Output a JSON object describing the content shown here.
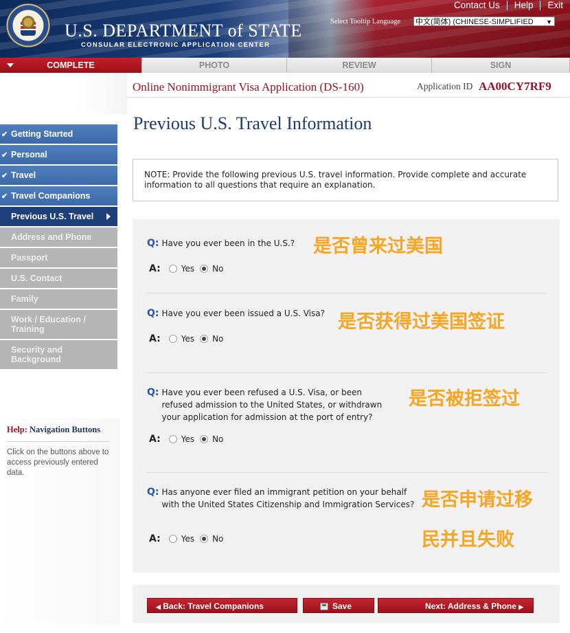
{
  "header": {
    "title": "U.S. DEPARTMENT of STATE",
    "subtitle": "CONSULAR ELECTRONIC APPLICATION CENTER",
    "links": [
      "Contact Us",
      "Help",
      "Exit"
    ],
    "tooltip_label": "Select Tooltip Language",
    "language_value": "中文(简体)  (CHINESE-SIMPLIFIED"
  },
  "tabs": [
    {
      "label": "COMPLETE",
      "active": true
    },
    {
      "label": "PHOTO"
    },
    {
      "label": "REVIEW"
    },
    {
      "label": "SIGN"
    }
  ],
  "application": {
    "title": "Online Nonimmigrant Visa Application (DS-160)",
    "id_label": "Application ID",
    "id_value": "AA00CY7RF9"
  },
  "page_title": "Previous U.S. Travel Information",
  "sidebar": {
    "items": [
      {
        "label": "Getting Started",
        "state": "done"
      },
      {
        "label": "Personal",
        "state": "done"
      },
      {
        "label": "Travel",
        "state": "done"
      },
      {
        "label": "Travel Companions",
        "state": "done"
      },
      {
        "label": "Previous U.S. Travel",
        "state": "current"
      },
      {
        "label": "Address and Phone",
        "state": "todo"
      },
      {
        "label": "Passport",
        "state": "todo"
      },
      {
        "label": "U.S. Contact",
        "state": "todo"
      },
      {
        "label": "Family",
        "state": "todo"
      },
      {
        "label": "Work / Education / Training",
        "state": "todo"
      },
      {
        "label": "Security and Background",
        "state": "todo"
      }
    ],
    "check": "✔"
  },
  "help": {
    "prefix": "Help:",
    "title": "Navigation Buttons",
    "text": "Click on the buttons above to access previously entered data."
  },
  "note": "NOTE: Provide the following previous U.S. travel information. Provide complete and accurate information to all questions that require an explanation.",
  "qa_labels": {
    "q": "Q:",
    "a": "A:",
    "yes": "Yes",
    "no": "No"
  },
  "questions": [
    {
      "text": "Have you ever been in the U.S.?",
      "answer": "No",
      "annotation": "是否曾来过美国"
    },
    {
      "text": "Have you ever been issued a U.S. Visa?",
      "answer": "No",
      "annotation": "是否获得过美国签证"
    },
    {
      "text": "Have you ever been refused a U.S. Visa, or been refused admission to the United States, or withdrawn your application for admission at the port of entry?",
      "answer": "No",
      "annotation": "是否被拒签过"
    },
    {
      "text": "Has anyone ever filed an immigrant petition on your behalf with the United States Citizenship and Immigration Services?",
      "answer": "No",
      "annotation": "是否申请过移民并且失败"
    }
  ],
  "annotation_lines": {
    "q4_line1": "是否申请过移",
    "q4_line2": "民并且失败"
  },
  "nav": {
    "back": "Back: Travel Companions",
    "save": "Save",
    "next": "Next: Address & Phone"
  },
  "colors": {
    "accent_red": "#9c1222",
    "nav_blue": "#3d6aa8",
    "annotation_orange": "#f5a623"
  }
}
